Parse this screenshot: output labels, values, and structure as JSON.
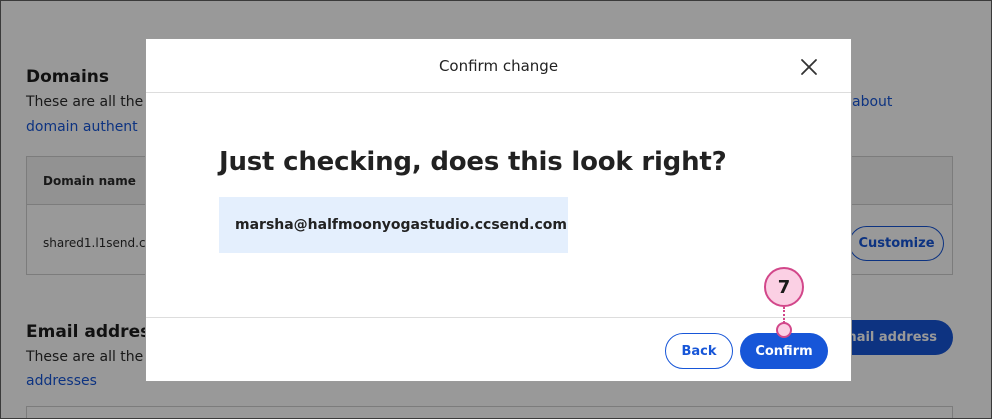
{
  "background": {
    "domains_title": "Domains",
    "domains_desc": "These are all the",
    "domains_link_left": "domain authent",
    "domains_link_right": "about",
    "table_header": "Domain name",
    "table_cell": "shared1.l1send.c",
    "customize_button": "Customize",
    "email_title": "Email addres",
    "email_desc": "These are all the",
    "email_link": "addresses",
    "add_email_button": "email address"
  },
  "modal": {
    "title": "Confirm change",
    "heading": "Just checking, does this look right?",
    "email": "marsha@halfmoonyogastudio.ccsend.com",
    "back_label": "Back",
    "confirm_label": "Confirm",
    "close_icon": "close-icon"
  },
  "callout": {
    "step_number": "7"
  },
  "colors": {
    "accent": "#1756d8",
    "email_box_bg": "#e4effd",
    "callout_fill": "#fbd0e4",
    "callout_border": "#d2478a"
  }
}
